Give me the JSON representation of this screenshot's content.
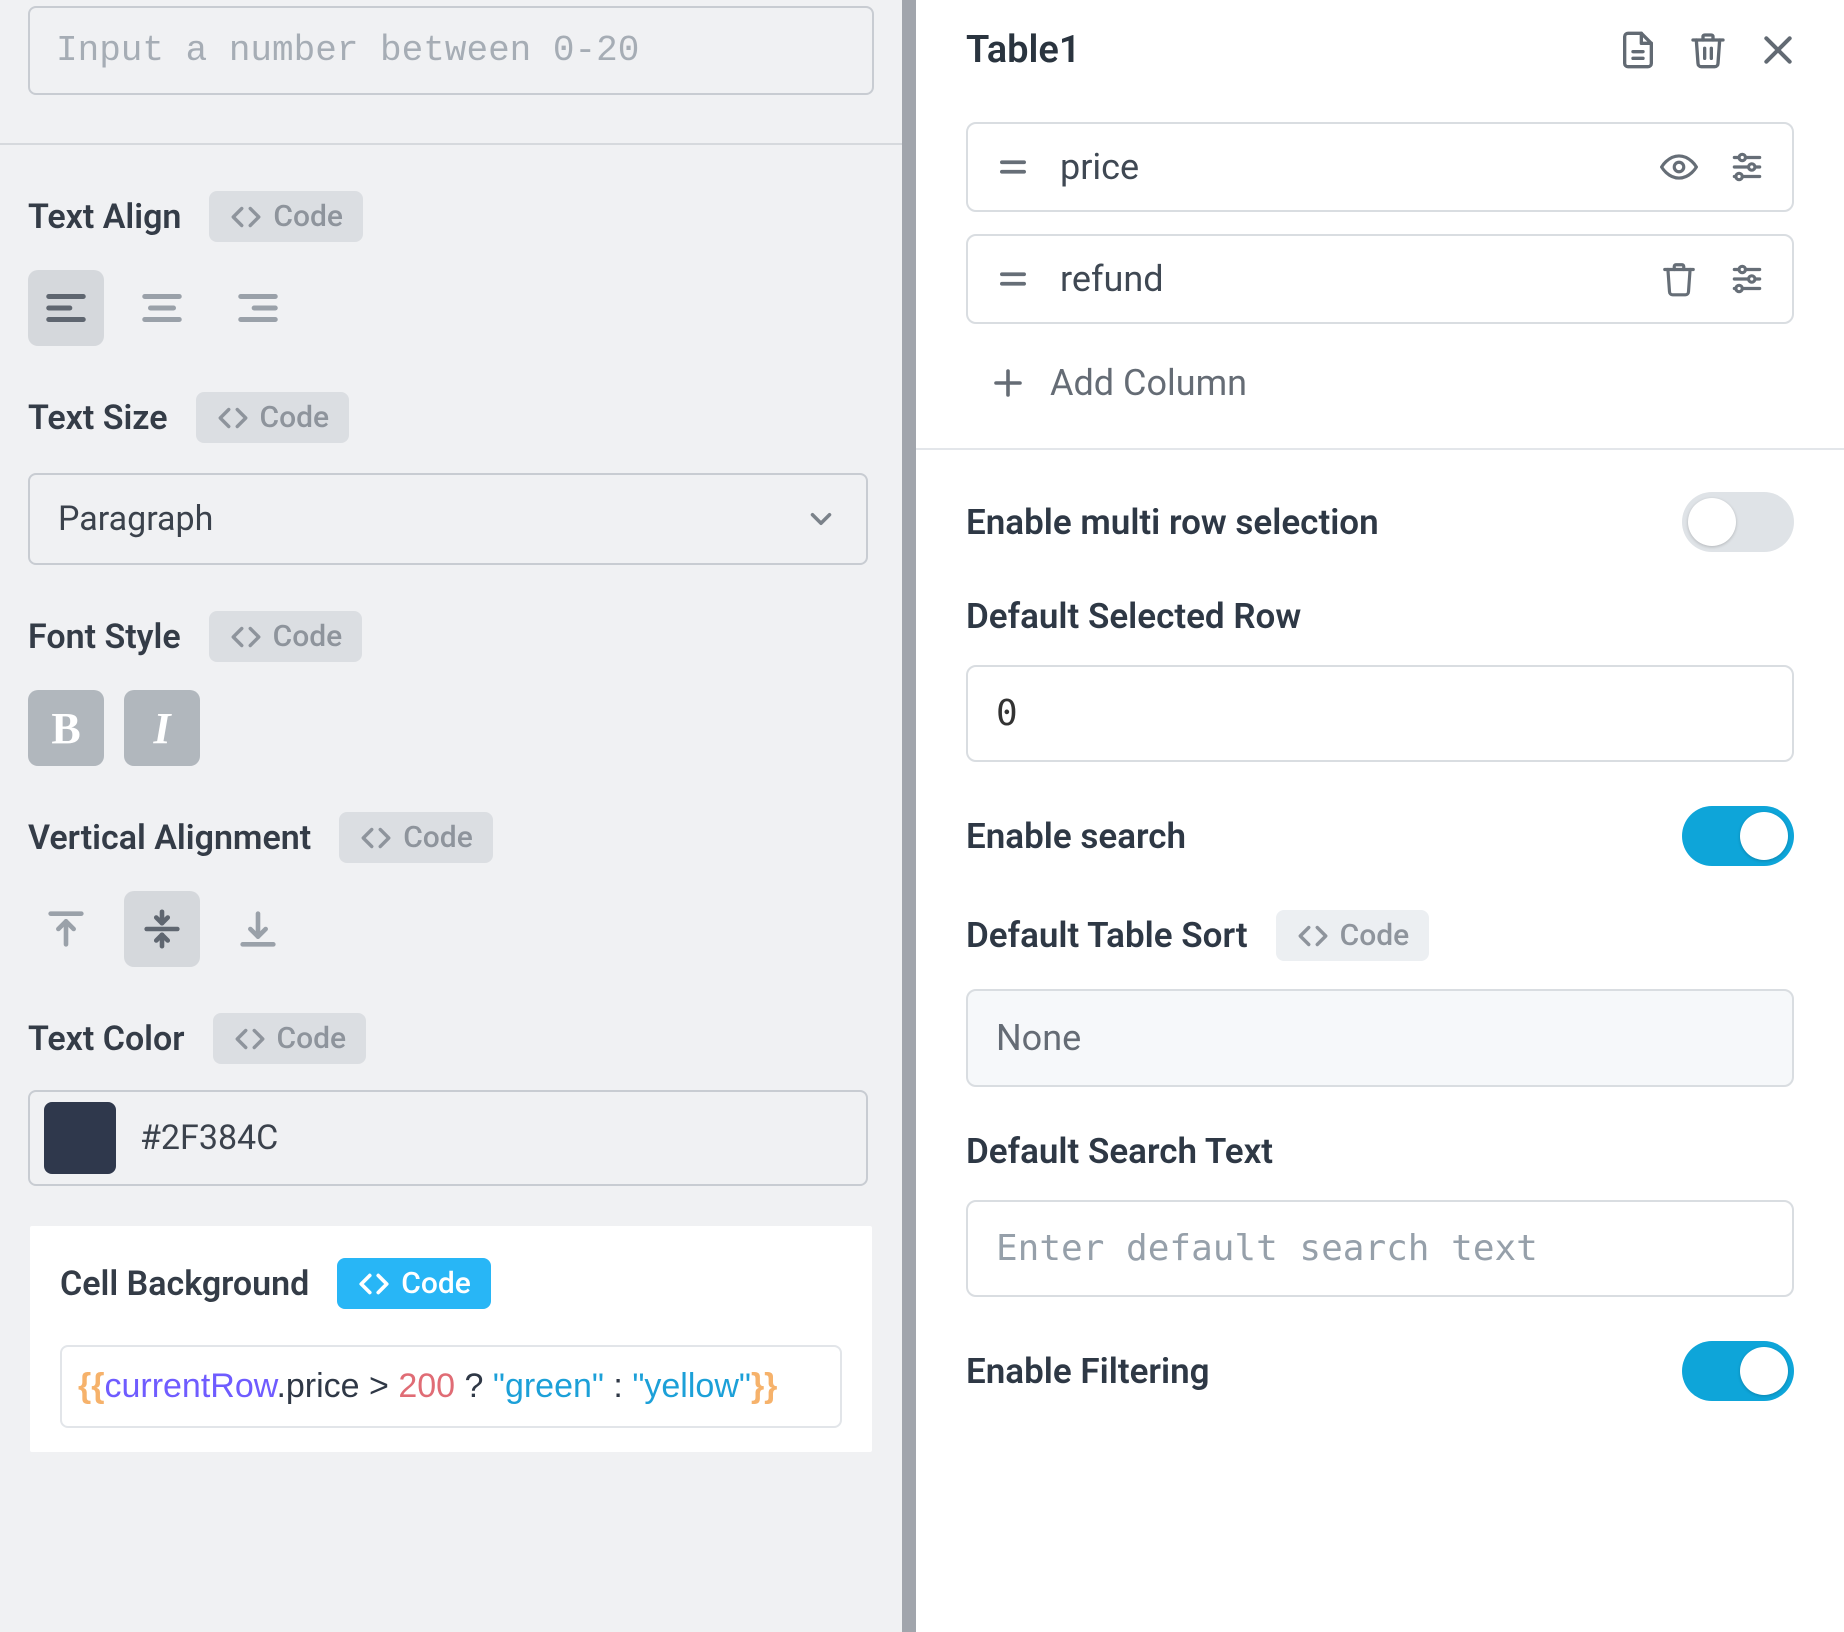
{
  "left": {
    "number_input_placeholder": "Input a number between 0-20",
    "code_pill_label": "Code",
    "text_align": {
      "label": "Text Align"
    },
    "text_size": {
      "label": "Text Size",
      "value": "Paragraph"
    },
    "font_style": {
      "label": "Font Style"
    },
    "vertical_alignment": {
      "label": "Vertical Alignment"
    },
    "text_color": {
      "label": "Text Color",
      "hex": "#2F384C"
    },
    "cell_background": {
      "label": "Cell Background",
      "expr": {
        "open": "{{",
        "ident": "currentRow",
        "dotpath": ".price > ",
        "number": "200",
        "mid": " ? ",
        "str1": "\"green\"",
        "sep": " : ",
        "str2": "\"yellow\"",
        "close": "}}"
      }
    }
  },
  "right": {
    "title": "Table1",
    "columns": [
      {
        "name": "price",
        "show_eye": true,
        "show_trash": false
      },
      {
        "name": "refund",
        "show_eye": false,
        "show_trash": true
      }
    ],
    "add_column_label": "Add Column",
    "settings": {
      "multi_row": {
        "label": "Enable multi row selection",
        "on": false
      },
      "default_row": {
        "label": "Default Selected Row",
        "value": "0"
      },
      "enable_search": {
        "label": "Enable search",
        "on": true
      },
      "default_sort": {
        "label": "Default Table Sort",
        "value": "None"
      },
      "default_search": {
        "label": "Default Search Text",
        "placeholder": "Enter default search text"
      },
      "enable_filter": {
        "label": "Enable Filtering",
        "on": true
      }
    },
    "code_pill_label": "Code"
  }
}
